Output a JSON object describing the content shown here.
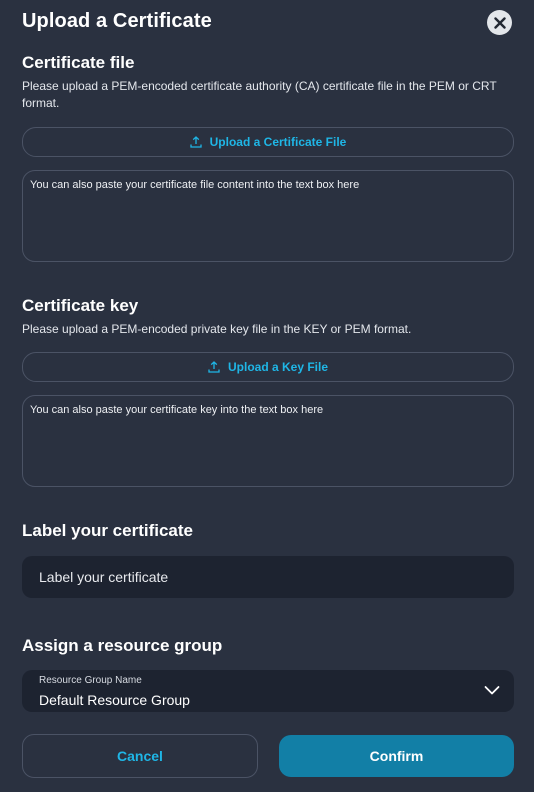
{
  "dialog": {
    "title": "Upload a Certificate",
    "close_icon": "close-icon"
  },
  "certificate_file": {
    "heading": "Certificate file",
    "description": "Please upload a PEM-encoded certificate authority (CA) certificate file in the PEM or CRT format.",
    "upload_label": "Upload a Certificate File",
    "upload_icon": "upload-icon",
    "textarea_placeholder": "You can also paste your certificate file content into the text box here"
  },
  "certificate_key": {
    "heading": "Certificate key",
    "description": "Please upload a PEM-encoded private key file in the KEY or PEM format.",
    "upload_label": "Upload a Key File",
    "upload_icon": "upload-icon",
    "textarea_placeholder": "You can also paste your certificate key into the text box here"
  },
  "label": {
    "heading": "Label your certificate",
    "placeholder": "Label your certificate"
  },
  "resource_group": {
    "heading": "Assign a resource group",
    "field_label": "Resource Group Name",
    "selected_value": "Default Resource Group",
    "dropdown_icon": "chevron-down-icon"
  },
  "actions": {
    "cancel_label": "Cancel",
    "confirm_label": "Confirm"
  },
  "colors": {
    "background": "#2a3140",
    "accent": "#1fb6e6",
    "confirm_bg": "#127fa6",
    "input_bg": "#1d2330"
  }
}
